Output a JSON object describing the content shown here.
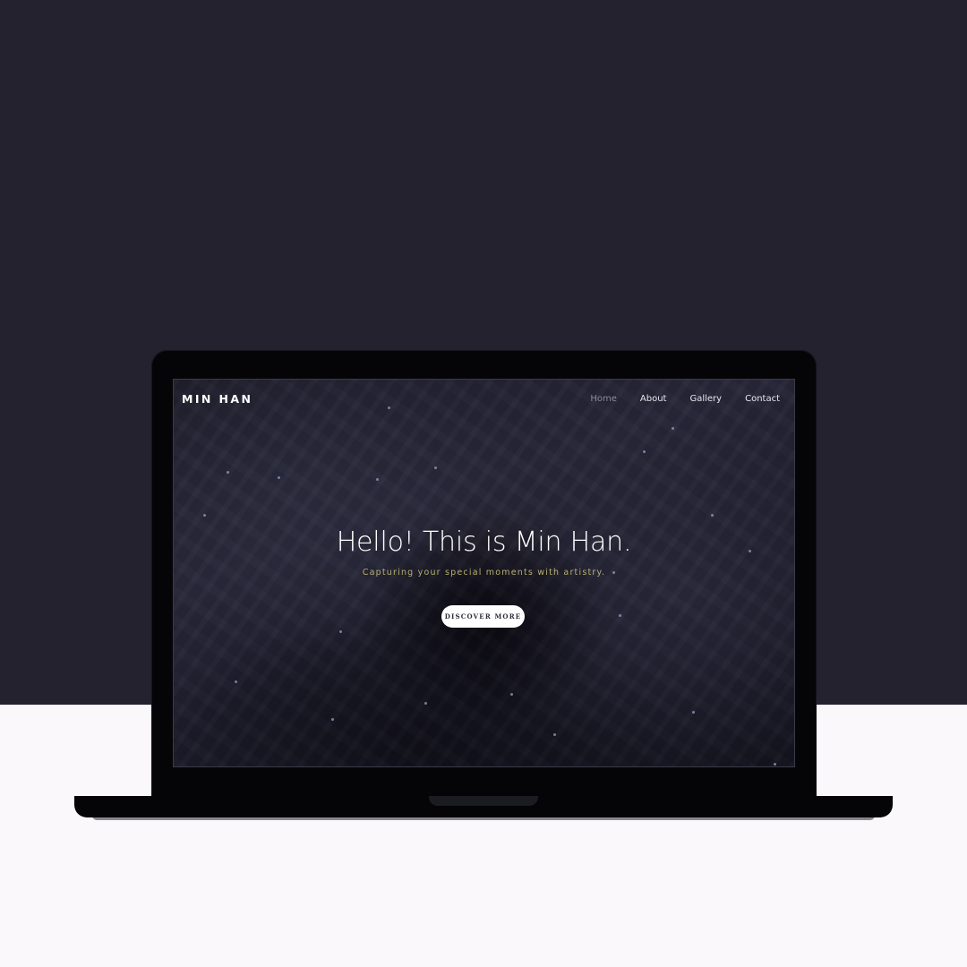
{
  "site": {
    "brand": "MIN HAN",
    "nav": [
      {
        "label": "Home",
        "active": true
      },
      {
        "label": "About",
        "active": false
      },
      {
        "label": "Gallery",
        "active": false
      },
      {
        "label": "Contact",
        "active": false
      }
    ],
    "hero": {
      "title": "Hello! This is Min Han.",
      "subtitle": "Capturing your special moments with artistry.",
      "cta_label": "DISCOVER MORE"
    }
  },
  "colors": {
    "backdrop_dark": "#23222e",
    "backdrop_light": "#fbf8fc",
    "laptop": "#050507",
    "subtitle_accent": "#b9b070",
    "nav_active": "#8b8b9c"
  }
}
